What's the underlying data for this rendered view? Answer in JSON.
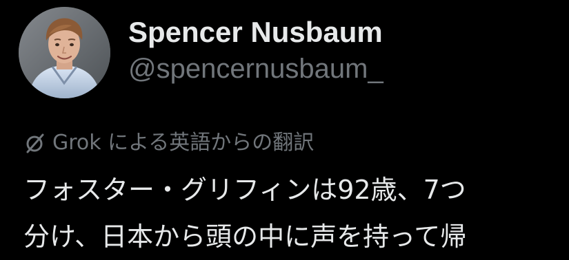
{
  "tweet": {
    "author": {
      "display_name": "Spencer Nusbaum",
      "handle": "@spencernusbaum_"
    },
    "translation_label": "Grok による英語からの翻訳",
    "translation_icon": "slashed-circle-icon",
    "text_lines": [
      "フォスター・グリフィンは92歳、7つ",
      "分け、日本から頭の中に声を持って帰"
    ]
  },
  "colors": {
    "background": "#000000",
    "primary_text": "#e7e9ea",
    "secondary_text": "#71767b"
  }
}
